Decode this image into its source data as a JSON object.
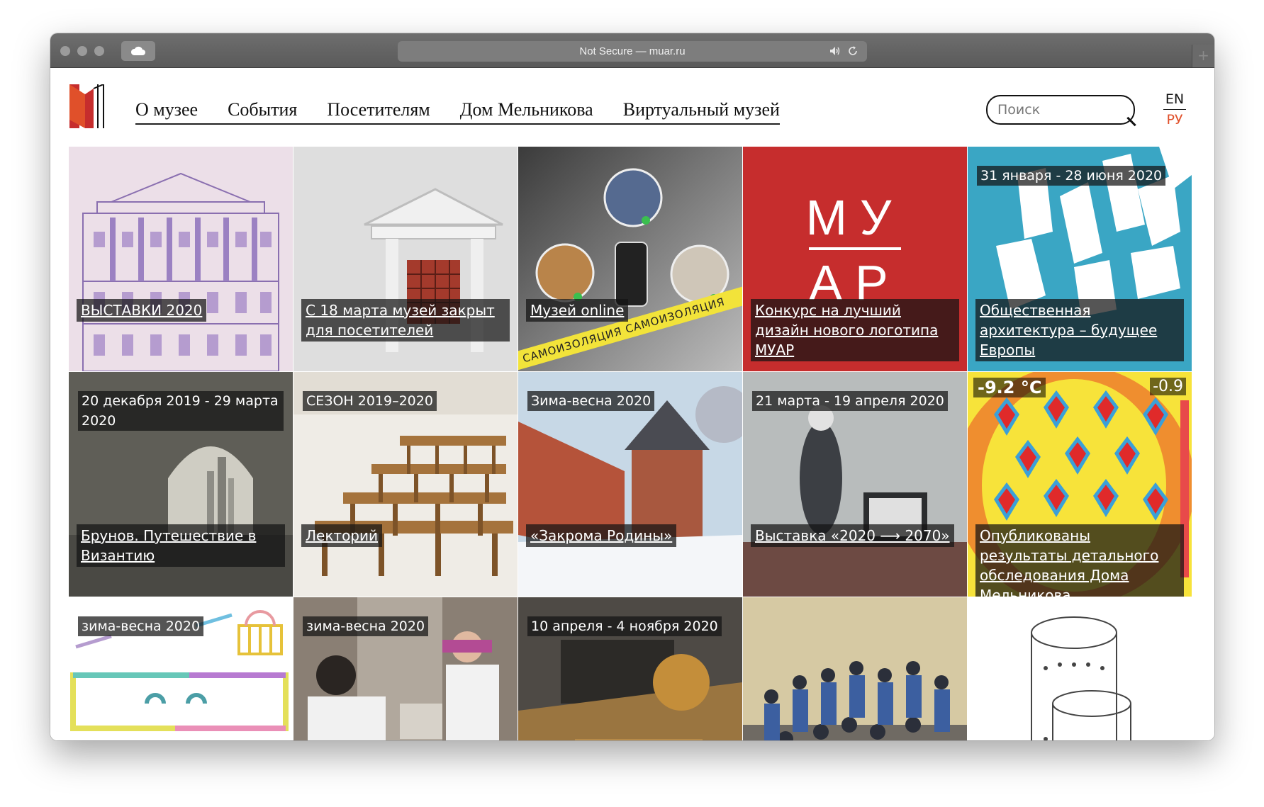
{
  "browser": {
    "address": "Not Secure — muar.ru"
  },
  "nav": {
    "items": [
      "О музее",
      "События",
      "Посетителям",
      "Дом Мельникова",
      "Виртуальный музей"
    ]
  },
  "search": {
    "placeholder": "Поиск"
  },
  "lang": {
    "en": "EN",
    "ru": "РУ"
  },
  "colors": {
    "accent": "#e0502a",
    "muar_red": "#c62d2d",
    "teal": "#3aa6c4"
  },
  "tiles": [
    {
      "date": "",
      "caption": "ВЫСТАВКИ 2020"
    },
    {
      "date": "",
      "caption": "С 18 марта музей закрыт для посетителей"
    },
    {
      "date": "",
      "caption": "Музей online",
      "tape": "САМОИЗОЛЯЦИЯ   САМОИЗОЛЯЦИЯ"
    },
    {
      "date": "",
      "caption": "Конкурс на лучший дизайн нового логотипа МУАР",
      "logo_top": "МУ",
      "logo_bottom": "АР"
    },
    {
      "date": "31 января - 28 июня 2020",
      "caption": "Общественная архитектура – будущее Европы"
    },
    {
      "date": "20 декабря 2019 - 29 марта 2020",
      "caption": "Брунов. Путешествие в Византию"
    },
    {
      "date": "СЕЗОН 2019–2020",
      "caption": "Лекторий"
    },
    {
      "date": "Зима-весна 2020",
      "caption": "«Закрома Родины»"
    },
    {
      "date": "21 марта - 19 апреля 2020",
      "caption": "Выставка «2020 ⟶ 2070»"
    },
    {
      "date": "",
      "caption": "Опубликованы результаты детального обследования Дома Мельникова",
      "temp_left": "-9.2 °C",
      "temp_right": "-0.9"
    },
    {
      "date": "зима-весна 2020",
      "caption": ""
    },
    {
      "date": "зима-весна 2020",
      "caption": ""
    },
    {
      "date": "10 апреля - 4 ноября 2020",
      "caption": ""
    },
    {
      "date": "",
      "caption": ""
    },
    {
      "date": "",
      "caption": ""
    }
  ]
}
